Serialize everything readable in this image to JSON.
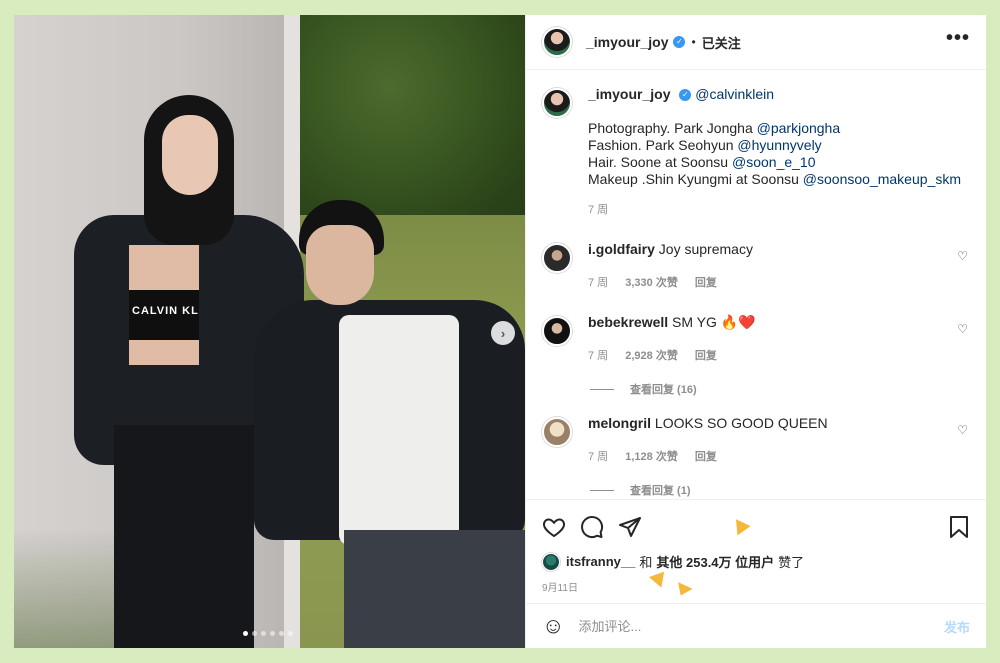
{
  "post": {
    "username": "_imyour_joy",
    "follow_status": "已关注",
    "separator": "•",
    "more_label": "•••",
    "slide_count": 6,
    "active_slide": 0
  },
  "caption": {
    "username": "_imyour_joy",
    "tag": "@calvinklein",
    "lines": [
      {
        "text": "Photography. Park Jongha ",
        "mention": "@parkjongha"
      },
      {
        "text": "Fashion. Park Seohyun ",
        "mention": "@hyunnyvely"
      },
      {
        "text": "Hair. Soone at Soonsu ",
        "mention": "@soon_e_10"
      },
      {
        "text": "Makeup .Shin Kyungmi at Soonsu ",
        "mention": "@soonsoo_makeup_skm"
      }
    ],
    "time": "7 周"
  },
  "photo_text": {
    "brand": "CALVIN KL"
  },
  "comments": [
    {
      "user": "i.goldfairy",
      "text": "Joy supremacy",
      "emoji": "",
      "time": "7 周",
      "likes": "3,330 次赞",
      "reply": "回复",
      "view_replies": ""
    },
    {
      "user": "bebekrewell",
      "text": "SM YG",
      "emoji": "🔥❤️",
      "time": "7 周",
      "likes": "2,928 次赞",
      "reply": "回复",
      "view_replies": "查看回复 (16)"
    },
    {
      "user": "melongril",
      "text": "LOOKS SO GOOD QUEEN",
      "emoji": "",
      "time": "7 周",
      "likes": "1,128 次赞",
      "reply": "回复",
      "view_replies": "查看回复 (1)"
    }
  ],
  "likes": {
    "user": "itsfranny__",
    "and": "和",
    "others": "其他 253.4万 位用户",
    "liked": "赞了"
  },
  "date": "9月11日",
  "composer": {
    "placeholder": "添加评论...",
    "post_label": "发布"
  },
  "colors": {
    "background": "#d9ecc0",
    "link": "#00376b",
    "verified": "#3897f0",
    "accent_spark": "#f4b83a"
  }
}
